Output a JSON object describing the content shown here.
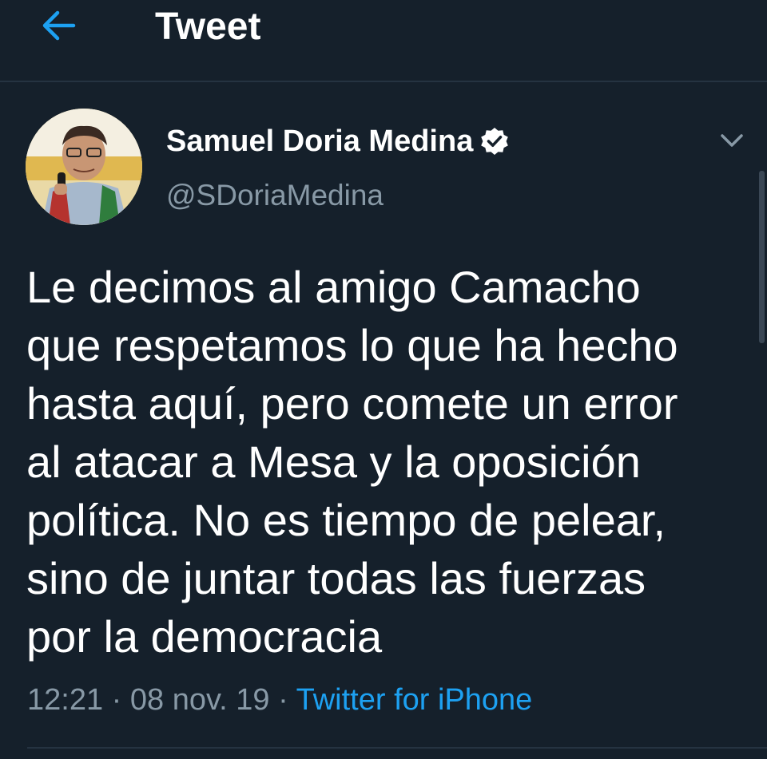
{
  "header": {
    "back_icon": "arrow-left-icon",
    "title": "Tweet",
    "accent_color": "#1da1f2"
  },
  "author": {
    "display_name": "Samuel Doria Medina",
    "verified_icon": "verified-badge-icon",
    "handle": "@SDoriaMedina",
    "more_icon": "chevron-down-icon"
  },
  "tweet": {
    "lines": [
      "Le decimos al amigo Camacho",
      "que respetamos lo que ha hecho",
      "hasta aquí, pero comete un error",
      "al atacar a Mesa y la oposición",
      "política. No es tiempo de pelear,",
      "sino de juntar todas las fuerzas",
      "por la democracia"
    ]
  },
  "meta": {
    "time": "12:21",
    "separator": " · ",
    "date": "08 nov. 19",
    "source": "Twitter for iPhone"
  },
  "colors": {
    "background": "#15202b",
    "text": "#ffffff",
    "secondary_text": "#8899a6",
    "divider": "#253341",
    "link": "#1da1f2"
  }
}
